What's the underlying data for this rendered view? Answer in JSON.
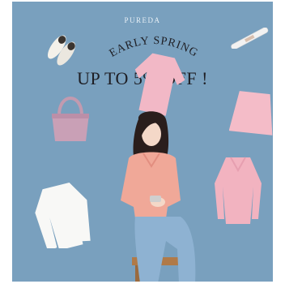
{
  "brand": "PUREDA",
  "headline": {
    "arc_text": "EARLY SPRING",
    "main_text": "UP TO 5% OFF !"
  },
  "colors": {
    "background": "#79a0be",
    "headline": "#1e1e24",
    "knit_pink": "#f2b8c6",
    "bag_mauve": "#c9a0b6",
    "cardigan_peach": "#f0a898",
    "jeans_blue": "#8eb2d2"
  },
  "items": [
    {
      "name": "loafers"
    },
    {
      "name": "hair-clip"
    },
    {
      "name": "pink-knit-top"
    },
    {
      "name": "shoulder-bag"
    },
    {
      "name": "pink-mini-skirt"
    },
    {
      "name": "pink-collar-sweater"
    },
    {
      "name": "white-blouse"
    },
    {
      "name": "model-photo"
    }
  ]
}
